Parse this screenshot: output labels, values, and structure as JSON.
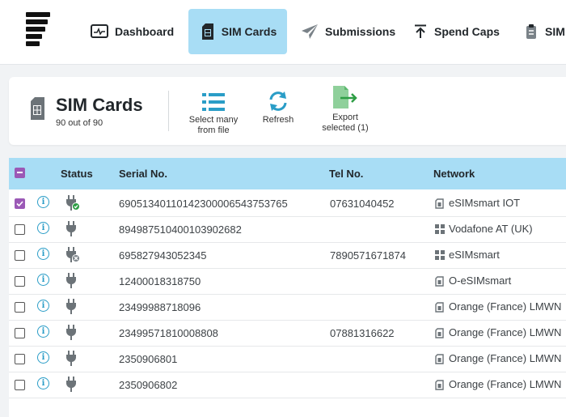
{
  "nav": {
    "items": [
      {
        "label": "Dashboard",
        "icon": "monitor-icon"
      },
      {
        "label": "SIM Cards",
        "icon": "sim-card-icon",
        "active": true
      },
      {
        "label": "Submissions",
        "icon": "paper-plane-icon"
      },
      {
        "label": "Spend Caps",
        "icon": "arrow-up-bar-icon"
      },
      {
        "label": "SIM",
        "icon": "clipboard-icon"
      }
    ]
  },
  "header": {
    "title": "SIM Cards",
    "subtitle": "90 out of 90",
    "select_many_label_1": "Select many",
    "select_many_label_2": "from file",
    "refresh_label": "Refresh",
    "export_label_1": "Export",
    "export_label_2": "selected (1)"
  },
  "table": {
    "columns": {
      "status": "Status",
      "serial": "Serial No.",
      "tel": "Tel No.",
      "network": "Network"
    },
    "rows": [
      {
        "checked": true,
        "status": "plug-ok",
        "serial": "69051340110142300006543753765",
        "tel": "07631040452",
        "network": "eSIMsmart IOT",
        "net_icon": "sim-icon"
      },
      {
        "checked": false,
        "status": "plug",
        "serial": "894987510400103902682",
        "tel": "",
        "network": "Vodafone AT (UK)",
        "net_icon": "grid-icon"
      },
      {
        "checked": false,
        "status": "plug-off",
        "serial": "695827943052345",
        "tel": "7890571671874",
        "network": "eSIMsmart",
        "net_icon": "grid-icon"
      },
      {
        "checked": false,
        "status": "plug",
        "serial": "12400018318750",
        "tel": "",
        "network": "O-eSIMsmart",
        "net_icon": "sim-icon"
      },
      {
        "checked": false,
        "status": "plug",
        "serial": "23499988718096",
        "tel": "",
        "network": "Orange (France) LMWN",
        "net_icon": "sim-icon"
      },
      {
        "checked": false,
        "status": "plug",
        "serial": "23499571810008808",
        "tel": "07881316622",
        "network": "Orange (France) LMWN",
        "net_icon": "sim-icon"
      },
      {
        "checked": false,
        "status": "plug",
        "serial": "2350906801",
        "tel": "",
        "network": "Orange (France) LMWN",
        "net_icon": "sim-icon"
      },
      {
        "checked": false,
        "status": "plug",
        "serial": "2350906802",
        "tel": "",
        "network": "Orange (France) LMWN",
        "net_icon": "sim-icon"
      }
    ]
  },
  "colors": {
    "accent": "#a8ddf5",
    "check": "#9b59b6",
    "info": "#2a9dc7",
    "ok": "#2e9e45"
  }
}
